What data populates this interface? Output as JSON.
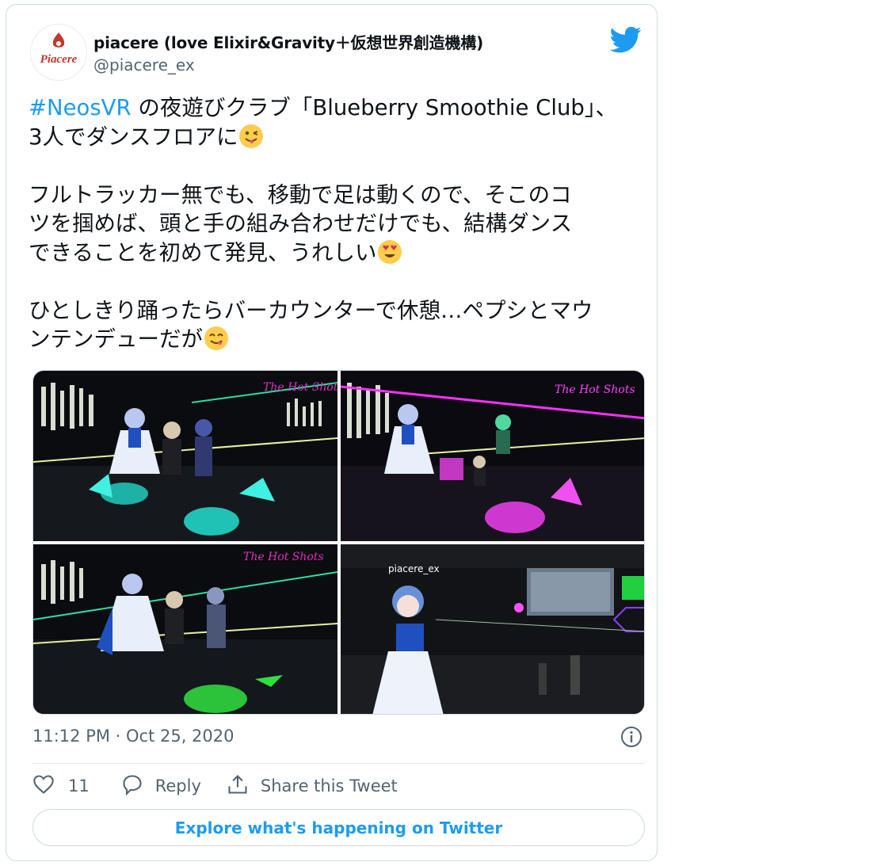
{
  "tweet": {
    "author": {
      "display_name": "piacere (love Elixir&Gravity＋仮想世界創造機構)",
      "handle": "@piacere_ex",
      "avatar_logo_text": "Piacere"
    },
    "text": {
      "line1_hashtag": "#NeosVR",
      "line1_rest": " の夜遊びクラブ「Blueberry Smoothie Club」、",
      "line2": "3人でダンスフロアに",
      "para2_line1": "フルトラッカー無でも、移動で足は動くので、そこのコ",
      "para2_line2": "ツを掴めば、頭と手の組み合わせだけでも、結構ダンス",
      "para2_line3": "できることを初めて発見、うれしい",
      "para3_line1": "ひとしきり踊ったらバーカウンターで休憩…ペプシとマウ",
      "para3_line2": "ンテンデューだが"
    },
    "emojis": [
      "winking-tongue-emoji",
      "heart-eyes-emoji",
      "yum-emoji"
    ],
    "media": [
      {
        "name": "photo-dance-floor-1",
        "accent": "#22e0d0"
      },
      {
        "name": "photo-dance-floor-2",
        "accent": "#e030e0"
      },
      {
        "name": "photo-dance-floor-3",
        "accent": "#30e040"
      },
      {
        "name": "photo-bar-counter",
        "accent": "#3060ff"
      }
    ],
    "timestamp": "11:12 PM · Oct 25, 2020",
    "actions": {
      "like_count": "11",
      "reply_label": "Reply",
      "share_label": "Share this Tweet"
    },
    "explore_label": "Explore what's happening on Twitter"
  },
  "colors": {
    "twitter_blue": "#1d9bf0",
    "secondary_text": "#536471",
    "border": "#cfd9de"
  }
}
